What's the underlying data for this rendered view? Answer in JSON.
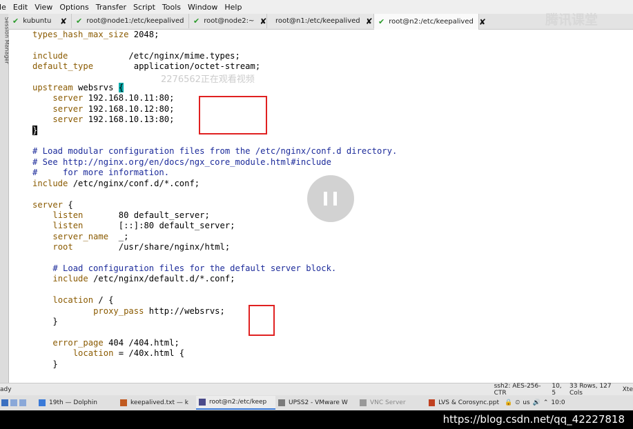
{
  "menu": [
    "ile",
    "Edit",
    "View",
    "Options",
    "Transfer",
    "Script",
    "Tools",
    "Window",
    "Help"
  ],
  "sidebar_label": "Session Manager",
  "tabs": [
    {
      "label": "kubuntu",
      "icon": "check-icon",
      "close": "✘",
      "active": false
    },
    {
      "label": "root@node1:/etc/keepalived",
      "icon": "check-icon",
      "close": "✘",
      "active": false
    },
    {
      "label": "root@node2:~",
      "icon": "check-icon",
      "close": "✘",
      "active": false
    },
    {
      "label": "root@n1:/etc/keepalived",
      "icon": "info-icon",
      "close": "✘",
      "active": false
    },
    {
      "label": "root@n2:/etc/keepalived",
      "icon": "check-icon",
      "close": "✘",
      "active": true
    }
  ],
  "code": {
    "l1": "types_hash_max_size",
    "l1v": " 2048;",
    "l3": "include",
    "l3v": "            /etc/nginx/mime.types;",
    "l4": "default_type",
    "l4v": "        application/octet-stream;",
    "l6k": "upstream",
    "l6v": " websrvs ",
    "l6b": "{",
    "l7k": "server",
    "l7v": " 192.168.10.11:80;",
    "l8k": "server",
    "l8v": " 192.168.10.12:80;",
    "l9k": "server",
    "l9v": " 192.168.10.13:80;",
    "l10": "}",
    "c1": "# Load modular configuration files from the /etc/nginx/conf.d directory.",
    "c2": "# See http://nginx.org/en/docs/ngx_core_module.html#include",
    "c3": "#     for more information.",
    "l15k": "include",
    "l15v": " /etc/nginx/conf.d/*.conf;",
    "l17k": "server",
    "l17v": " {",
    "l18k": "listen",
    "l18v": "       80 default_server;",
    "l19k": "listen",
    "l19v": "       [::]:80 default_server;",
    "l20k": "server_name",
    "l20v": "  _;",
    "l21k": "root",
    "l21v": "         /usr/share/nginx/html;",
    "c4": "# Load configuration files for the default server block.",
    "l24k": "include",
    "l24v": " /etc/nginx/default.d/*.conf;",
    "l26k": "location",
    "l26v": " / {",
    "l27k": "proxy_pass",
    "l27v": " http://websrvs;",
    "l28": "}",
    "l30k": "error_page",
    "l30v": " 404 /404.html;",
    "l31k": "location",
    "l31v": " = /40x.html {",
    "l32": "}"
  },
  "watermark": "2276562正在观看视频",
  "logo": "腾讯课堂",
  "status": {
    "left": "ady",
    "ssh": "ssh2: AES-256-CTR",
    "pos": "10, 5",
    "rowscols": "33 Rows, 127 Cols",
    "term": "Xte"
  },
  "taskbar": [
    {
      "label": "19th — Dolphin",
      "active": false
    },
    {
      "label": "keepalived.txt — k",
      "active": false
    },
    {
      "label": "root@n2:/etc/keep",
      "active": true
    },
    {
      "label": "UPSS2 - VMware W",
      "active": false
    },
    {
      "label": "VNC Server",
      "active": false
    },
    {
      "label": "LVS & Corosync.ppt",
      "active": false
    }
  ],
  "tray": {
    "lang": "us",
    "time": "10:0"
  },
  "footer_url": "https://blog.csdn.net/qq_42227818",
  "colors": {
    "keyword": "#8a5a00",
    "comment": "#1b2a9a",
    "cursor": "#00aaaa",
    "highlight_box": "#e02020"
  }
}
